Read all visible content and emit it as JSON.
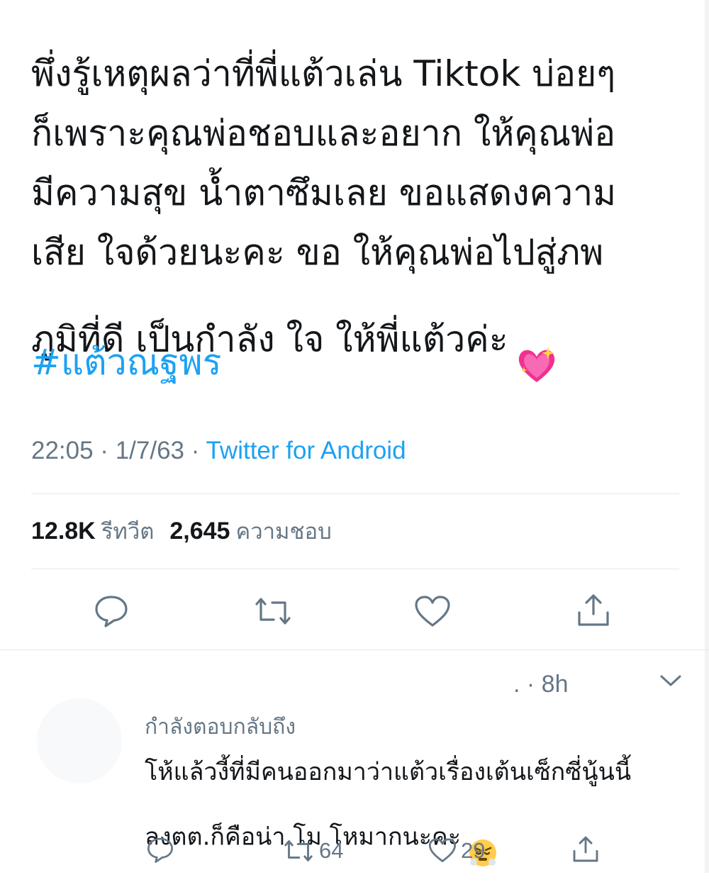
{
  "tweet": {
    "text": "พึ่งรู้เหตุผลว่าที่พี่แต้วเล่น Tiktok บ่อยๆ\nก็เพราะคุณพ่อชอบและอยาก ให้คุณพ่อ\nมีความสุข น้ำตาซึมเลย ขอแสดงความ\nเสีย ใจด้วยนะคะ ขอ ให้คุณพ่อไปสู่ภพ\nภูมิที่ดี เป็นกำลัง ใจ ให้พี่แต้วค่ะ",
    "emoji": "sparkling-heart",
    "hashtag": "#แต้วณฐพร",
    "time": "22:05 · 1/7/63 · ",
    "source": "Twitter for Android",
    "retweets_count": "12.8K",
    "retweets_label": "รีทวีต",
    "likes_count": "2,645",
    "likes_label": "ความชอบ"
  },
  "reply": {
    "time": ". · 8h",
    "replying_to": "กำลังตอบกลับถึง",
    "text": "โห้แล้วงี้ที่มีคนออกมาว่าแต้วเรื่องเต้นเซ็กซี่นู้นนี้\nลงตต.ก็คือน่า โม โหมากนะคะ",
    "emoji": "face-with-steam",
    "retweets": "64",
    "likes": "29"
  },
  "colors": {
    "link": "#1da1f2",
    "muted": "#657786",
    "text": "#14171a"
  }
}
